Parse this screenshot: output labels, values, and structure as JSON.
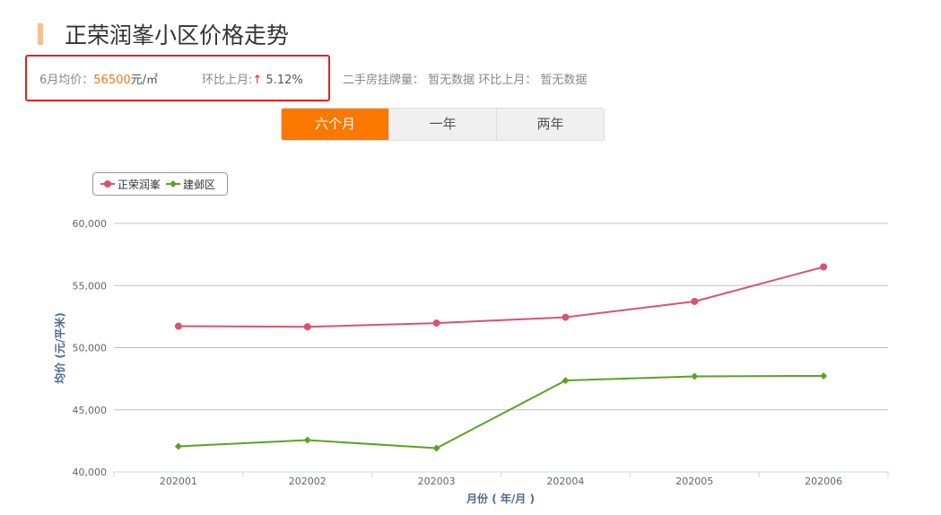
{
  "title": "正荣润峯小区价格走势",
  "summary": {
    "avg_label": "6月均价：",
    "avg_value": "56500",
    "avg_unit": "元/㎡",
    "mom_label": "环比上月:",
    "mom_arrow": "↑",
    "mom_value": " 5.12%",
    "listing_text": "二手房挂牌量： 暂无数据 环比上月： 暂无数据"
  },
  "tabs": [
    {
      "label": "六个月",
      "active": true
    },
    {
      "label": "一年",
      "active": false
    },
    {
      "label": "两年",
      "active": false
    }
  ],
  "colors": {
    "series1": "#d9536f",
    "series2": "#5aa322",
    "accent": "#fb7800"
  },
  "chart_data": {
    "type": "line",
    "categories": [
      "202001",
      "202002",
      "202003",
      "202004",
      "202005",
      "202006"
    ],
    "series": [
      {
        "name": "正荣润峯",
        "values": [
          51730,
          51680,
          51980,
          52450,
          53720,
          56500
        ]
      },
      {
        "name": "建邺区",
        "values": [
          42060,
          42560,
          41910,
          47360,
          47690,
          47730
        ]
      }
    ],
    "yticks": [
      "40,000",
      "45,000",
      "50,000",
      "55,000",
      "60,000"
    ],
    "ylim": [
      40000,
      60000
    ],
    "xlabel": "月份 ( 年/月 )",
    "ylabel": "均价 (元/平米)",
    "legend": "top-left",
    "grid": true
  }
}
